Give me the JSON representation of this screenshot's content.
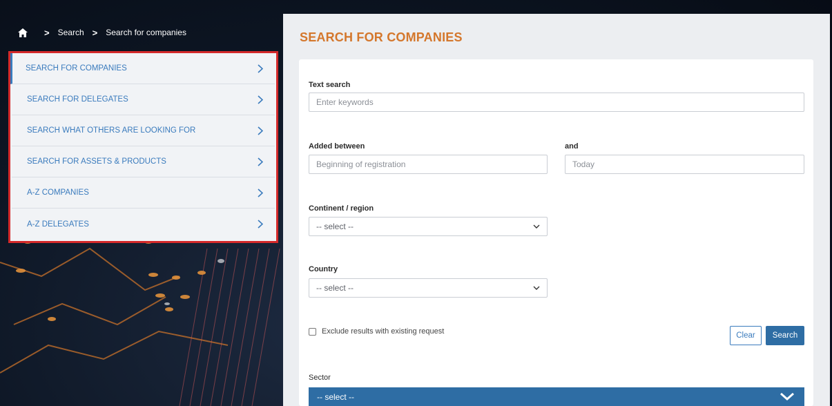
{
  "breadcrumb": {
    "home_icon": "home-icon",
    "items": [
      "Search",
      "Search for companies"
    ]
  },
  "side_menu": {
    "accent_color": "#3a7bbd",
    "highlight_border_color": "#d4292a",
    "items": [
      {
        "label": "SEARCH FOR COMPANIES",
        "active": true
      },
      {
        "label": "SEARCH FOR DELEGATES"
      },
      {
        "label": "SEARCH WHAT OTHERS ARE LOOKING FOR"
      },
      {
        "label": "SEARCH FOR ASSETS & PRODUCTS"
      },
      {
        "label": "A-Z COMPANIES"
      },
      {
        "label": "A-Z DELEGATES"
      }
    ]
  },
  "main": {
    "title": "SEARCH FOR COMPANIES",
    "title_color": "#d4772c",
    "text_search": {
      "label": "Text search",
      "placeholder": "Enter keywords"
    },
    "added_between": {
      "label": "Added between",
      "placeholder": "Beginning of registration"
    },
    "and_field": {
      "label": "and",
      "placeholder": "Today"
    },
    "continent": {
      "label": "Continent / region",
      "value": "-- select --"
    },
    "country": {
      "label": "Country",
      "value": "-- select --"
    },
    "exclude_checkbox": {
      "label": "Exclude results with existing request",
      "checked": false
    },
    "buttons": {
      "clear": "Clear",
      "search": "Search"
    },
    "sector": {
      "label": "Sector",
      "value": "-- select --"
    }
  }
}
